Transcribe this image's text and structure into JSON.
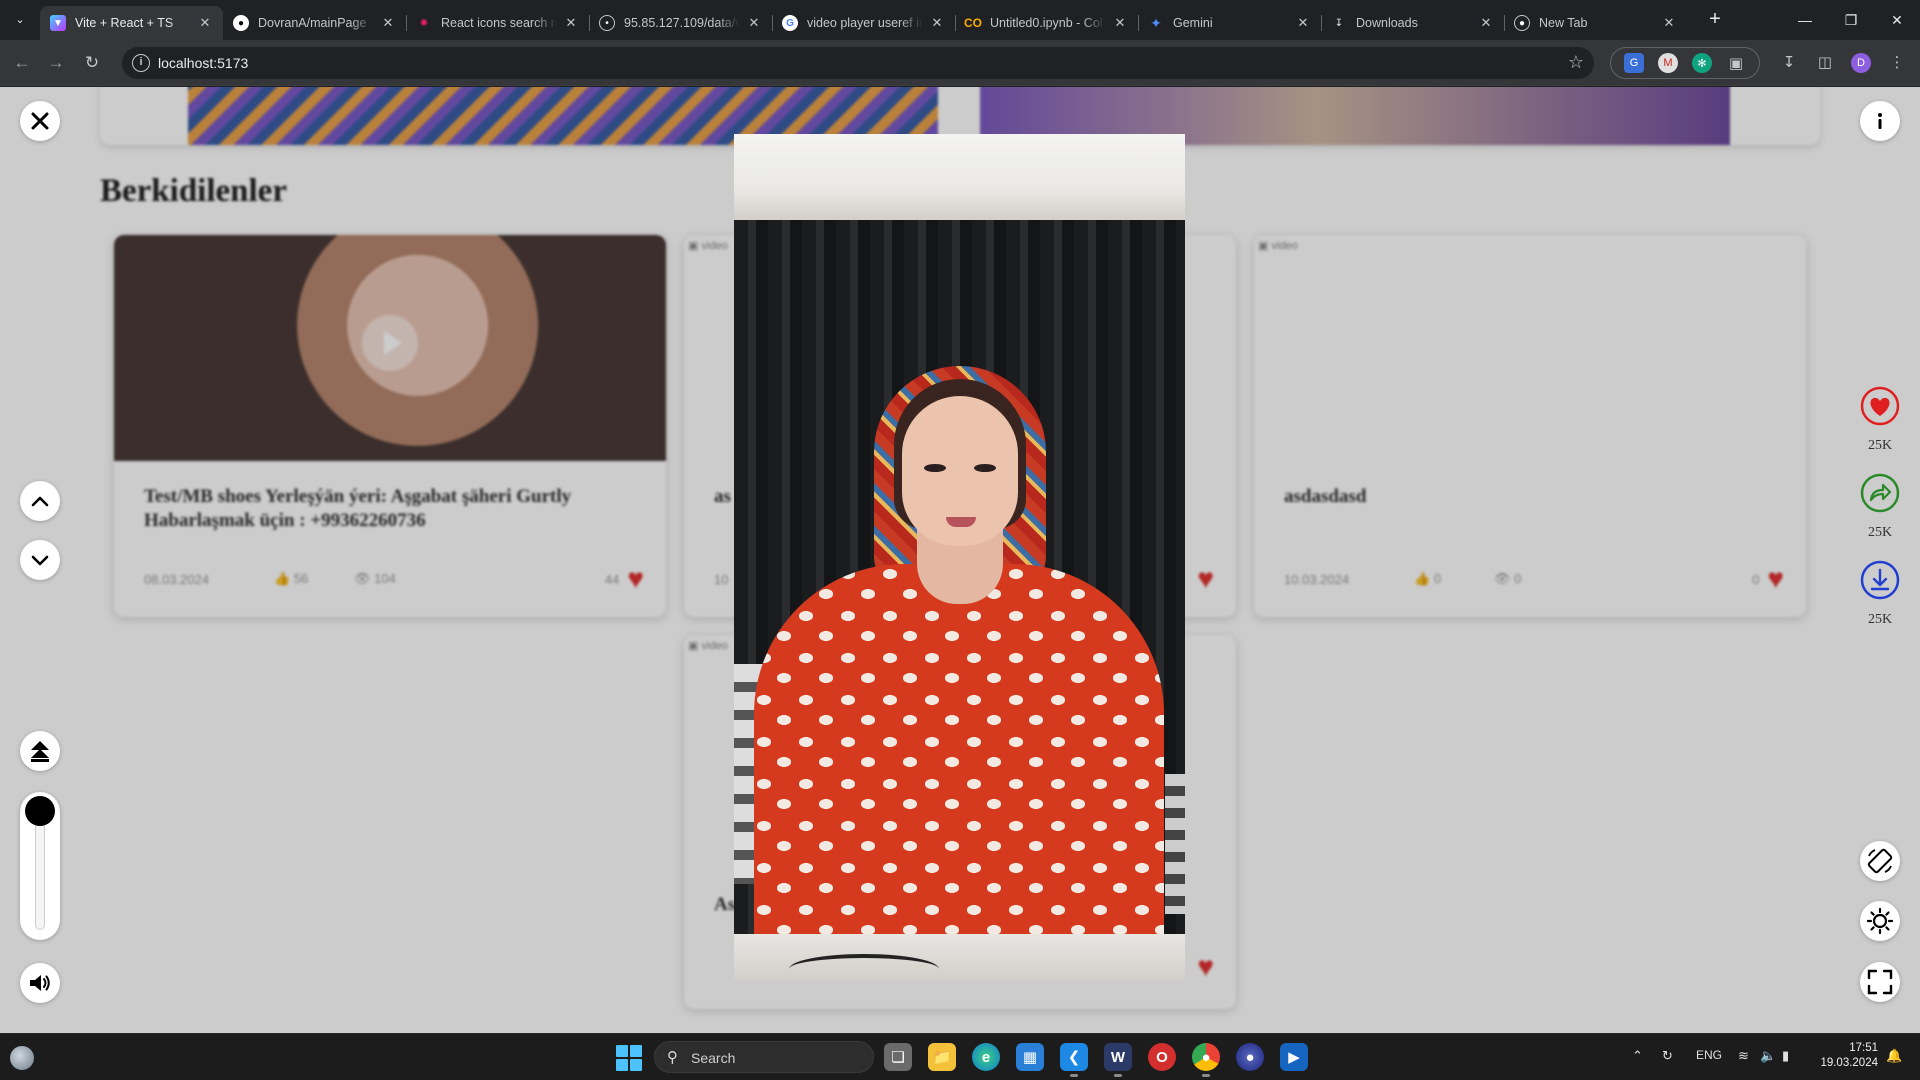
{
  "browser": {
    "tabs": [
      {
        "title": "Vite + React + TS",
        "favicon": "vite-icon",
        "active": true
      },
      {
        "title": "DovranA/mainPage",
        "favicon": "github-icon",
        "active": false
      },
      {
        "title": "React icons search re",
        "favicon": "react-icons-icon",
        "active": false
      },
      {
        "title": "95.85.127.109/data/v",
        "favicon": "globe-icon",
        "active": false
      },
      {
        "title": "video player useref in",
        "favicon": "google-icon",
        "active": false
      },
      {
        "title": "Untitled0.ipynb - Col",
        "favicon": "colab-icon",
        "active": false
      },
      {
        "title": "Gemini",
        "favicon": "gemini-icon",
        "active": false
      },
      {
        "title": "Downloads",
        "favicon": "download-icon",
        "active": false
      },
      {
        "title": "New Tab",
        "favicon": "chrome-icon",
        "active": false
      }
    ],
    "address": "localhost:5173",
    "profile_initial": "D"
  },
  "page": {
    "section_title": "Berkidilenler",
    "cards": [
      {
        "title": "Test/MB shoes Yerleşýän ýeri: Aşgabat şäheri Gurtly Habarlaşmak üçin : +99362260736",
        "date": "08.03.2024",
        "likes": "56",
        "views": "104",
        "favorites": "44"
      },
      {
        "title": "as",
        "date": "10",
        "likes": "",
        "views": "",
        "favorites": ""
      },
      {
        "title": "asdasdasd",
        "date": "10.03.2024",
        "likes": "0",
        "views": "0",
        "favorites": "0"
      },
      {
        "title": "As",
        "date": "",
        "likes": "",
        "views": "",
        "favorites": ""
      }
    ],
    "broken_image_alt": "video"
  },
  "player": {
    "volume_level": 1.0,
    "actions": [
      {
        "name": "like",
        "count": "25K",
        "color": "#e02020"
      },
      {
        "name": "share",
        "count": "25K",
        "color": "#2a8a2a"
      },
      {
        "name": "download",
        "count": "25K",
        "color": "#1f3fd1"
      }
    ]
  },
  "taskbar": {
    "search_label": "Search",
    "language": "ENG",
    "time": "17:51",
    "date": "19.03.2024"
  }
}
